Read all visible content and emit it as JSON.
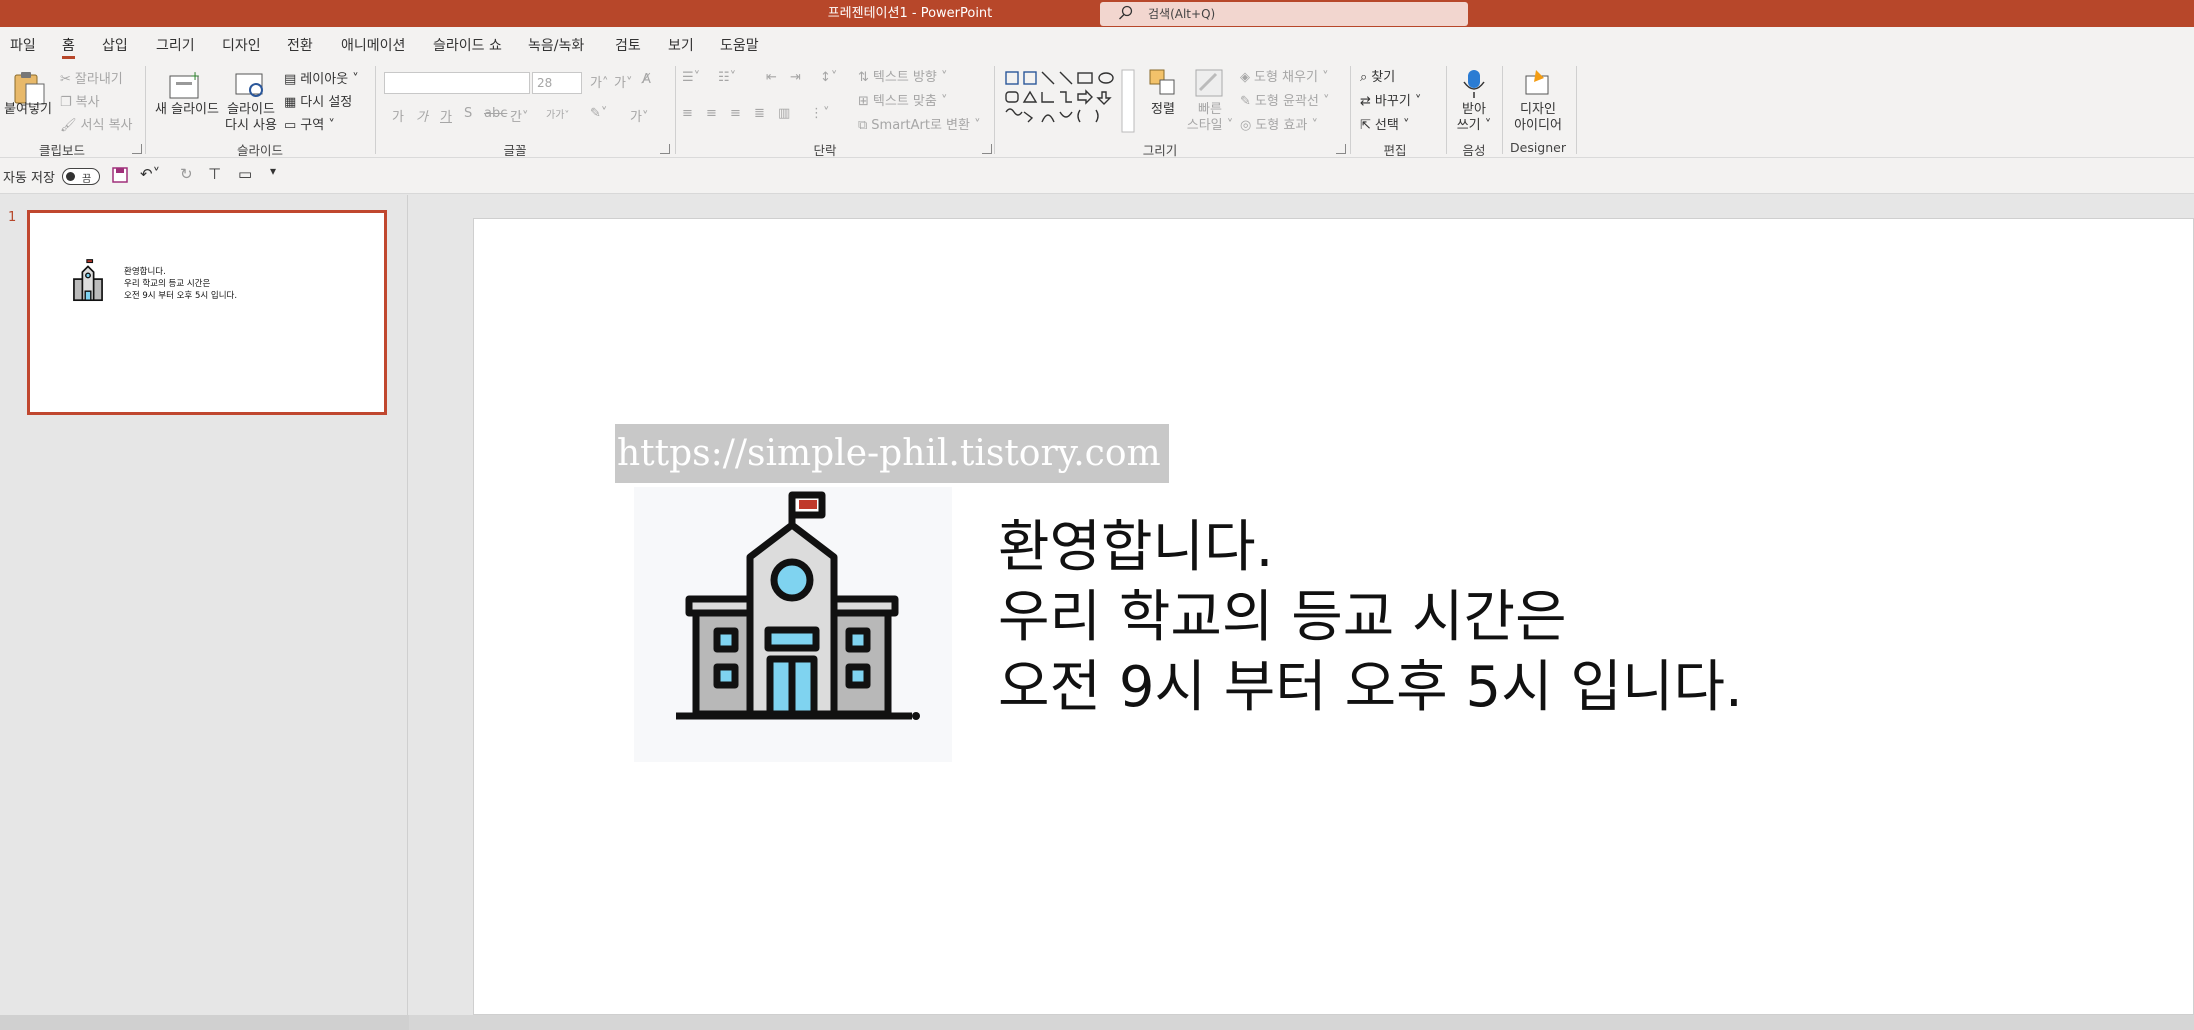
{
  "window": {
    "title": "프레젠테이션1  -  PowerPoint"
  },
  "search": {
    "placeholder": "검색(Alt+Q)"
  },
  "menu": {
    "tabs": [
      "파일",
      "홈",
      "삽입",
      "그리기",
      "디자인",
      "전환",
      "애니메이션",
      "슬라이드 쇼",
      "녹음/녹화",
      "검토",
      "보기",
      "도움말"
    ],
    "active": "홈"
  },
  "ribbon": {
    "clipboard": {
      "paste": "붙여넣기",
      "cut": "잘라내기",
      "copy": "복사",
      "format_painter": "서식 복사",
      "label": "클립보드"
    },
    "slides": {
      "new_slide": "새 슬라이드",
      "reuse_1": "슬라이드",
      "reuse_2": "다시 사용",
      "layout": "레이아웃",
      "reset": "다시 설정",
      "section": "구역",
      "label": "슬라이드"
    },
    "font": {
      "size": "28",
      "label": "글꼴"
    },
    "paragraph": {
      "text_direction": "텍스트 방향",
      "align_text": "텍스트 맞춤",
      "smartart": "SmartArt로 변환",
      "label": "단락"
    },
    "drawing": {
      "arrange": "정렬",
      "quick_1": "빠른",
      "quick_2": "스타일",
      "shape_fill": "도형 채우기",
      "shape_outline": "도형 윤곽선",
      "shape_effects": "도형 효과",
      "label": "그리기"
    },
    "editing": {
      "find": "찾기",
      "replace": "바꾸기",
      "select": "선택",
      "label": "편집"
    },
    "voice": {
      "dictate_1": "받아",
      "dictate_2": "쓰기",
      "label": "음성"
    },
    "designer": {
      "ideas_1": "디자인",
      "ideas_2": "아이디어",
      "label": "Designer"
    }
  },
  "qat": {
    "autosave": "자동 저장",
    "toggle_state": "끔"
  },
  "thumbnail": {
    "number": "1",
    "lines": [
      "환영합니다.",
      "우리 학교의 등교 시간은",
      "오전 9시 부터 오후 5시 입니다."
    ]
  },
  "slide": {
    "url_overlay": "https://simple-phil.tistory.com",
    "lines": [
      "환영합니다.",
      "우리 학교의 등교 시간은",
      "오전 9시 부터 오후 5시 입니다."
    ]
  },
  "colors": {
    "accent": "#b7472a",
    "ribbon_bg": "#f3f2f1",
    "canvas_bg": "#e6e6e6"
  }
}
